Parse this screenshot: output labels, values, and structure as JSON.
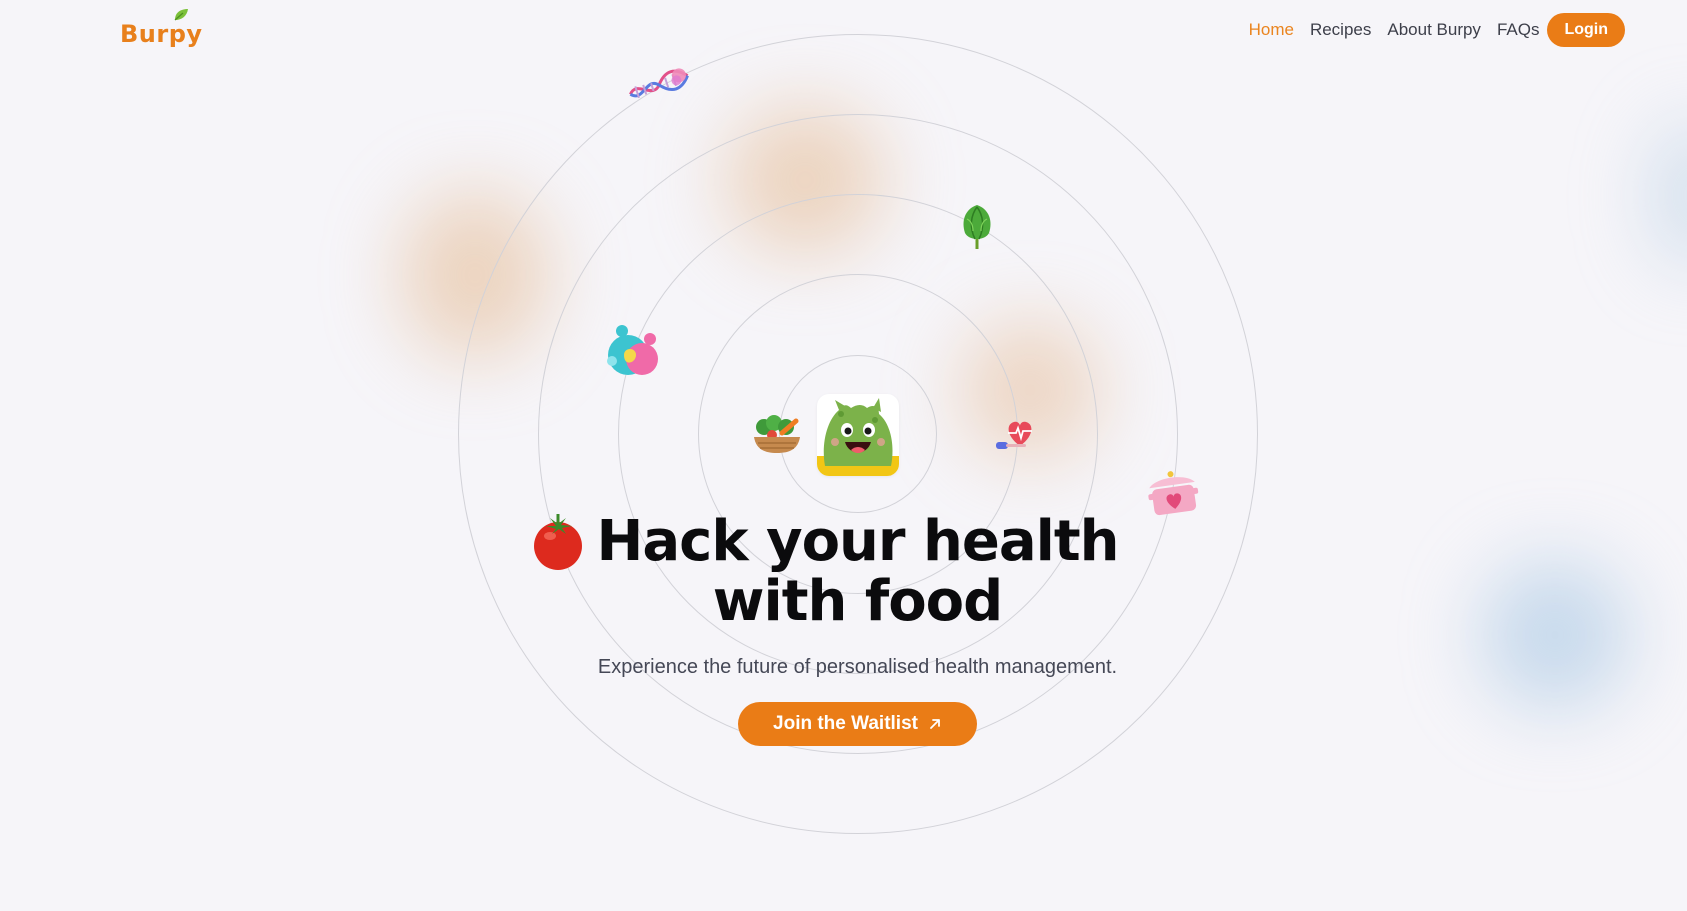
{
  "brand": {
    "logo_text_a": "Bur",
    "logo_text_b": "p",
    "logo_text_c": "y",
    "accent": "#ea7c16"
  },
  "nav": {
    "items": [
      {
        "label": "Home",
        "active": true
      },
      {
        "label": "Recipes",
        "active": false
      },
      {
        "label": "About Burpy",
        "active": false
      },
      {
        "label": "FAQs",
        "active": false
      }
    ],
    "login_label": "Login"
  },
  "hero": {
    "title_line1": "Hack your health",
    "title_line2": "with food",
    "subtitle": "Experience the future of personalised health management.",
    "cta_label": "Join the Waitlist"
  },
  "icons": [
    "dna-icon",
    "lettuce-icon",
    "gut-health-icon",
    "veggie-basket-icon",
    "mascot-icon",
    "heart-rate-icon",
    "cooking-pot-icon",
    "tomato-icon"
  ]
}
